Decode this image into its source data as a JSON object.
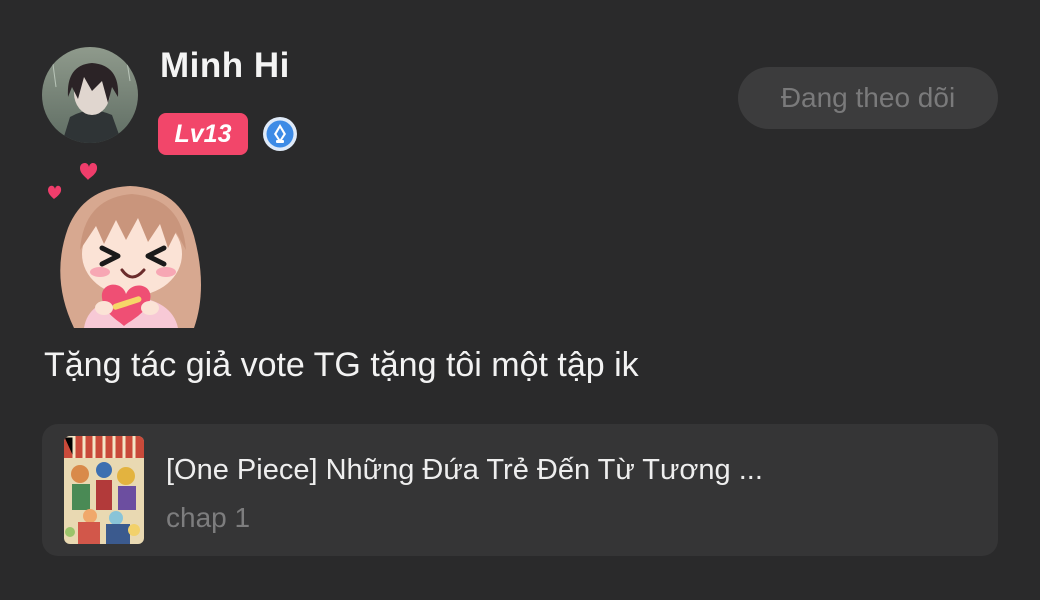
{
  "comment": {
    "user": {
      "name": "Minh Hi",
      "level_badge": "Lv13",
      "verified_icon": "verified-badge-icon",
      "avatar_icon": "avatar-image"
    },
    "follow_button": {
      "label": "Đang theo dõi"
    },
    "sticker_icon": "girl-hugging-heart-sticker",
    "text": "Tặng tác giả vote TG tặng tôi một tập ik",
    "linked_book": {
      "title": "[One Piece] Những Đứa Trẻ Đến Từ Tương ...",
      "chapter": "chap 1",
      "cover_icon": "book-cover-image"
    }
  },
  "colors": {
    "background": "#2a2a2b",
    "level_badge": "#f2466a",
    "verified": "#3d8be6",
    "card": "#353536",
    "button": "#3c3c3d"
  }
}
